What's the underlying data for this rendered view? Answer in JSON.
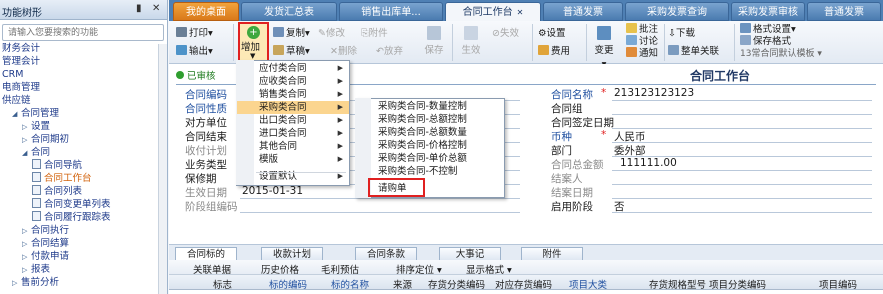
{
  "sidebar": {
    "title": "功能树形",
    "search_placeholder": "请输入您要搜索的功能",
    "items": [
      {
        "label": "财务会计",
        "level": 0,
        "type": "branch"
      },
      {
        "label": "管理会计",
        "level": 0,
        "type": "branch"
      },
      {
        "label": "CRM",
        "level": 0,
        "type": "branch"
      },
      {
        "label": "电商管理",
        "level": 0,
        "type": "branch"
      },
      {
        "label": "供应链",
        "level": 0,
        "type": "branch"
      },
      {
        "label": "合同管理",
        "level": 1,
        "type": "open"
      },
      {
        "label": "设置",
        "level": 2,
        "type": "closed"
      },
      {
        "label": "合同期初",
        "level": 2,
        "type": "closed"
      },
      {
        "label": "合同",
        "level": 2,
        "type": "open"
      },
      {
        "label": "合同导航",
        "level": 3,
        "type": "doc"
      },
      {
        "label": "合同工作台",
        "level": 3,
        "type": "doc",
        "selected": true
      },
      {
        "label": "合同列表",
        "level": 3,
        "type": "doc"
      },
      {
        "label": "合同变更单列表",
        "level": 3,
        "type": "doc"
      },
      {
        "label": "合同履行跟踪表",
        "level": 3,
        "type": "doc"
      },
      {
        "label": "合同执行",
        "level": 2,
        "type": "closed"
      },
      {
        "label": "合同结算",
        "level": 2,
        "type": "closed"
      },
      {
        "label": "付款申请",
        "level": 2,
        "type": "closed"
      },
      {
        "label": "报表",
        "level": 2,
        "type": "closed"
      },
      {
        "label": "售前分析",
        "level": 1,
        "type": "closed"
      }
    ]
  },
  "tabs": [
    {
      "label": "我的桌面"
    },
    {
      "label": "发货汇总表"
    },
    {
      "label": "销售出库单..."
    },
    {
      "label": "合同工作台"
    },
    {
      "label": "普通发票"
    },
    {
      "label": "采购发票查询"
    },
    {
      "label": "采购发票审核"
    },
    {
      "label": "普通发票"
    }
  ],
  "toolbar": {
    "print": "打印",
    "export": "输出",
    "add": "增加",
    "copy": "复制",
    "modify": "修改",
    "attachment": "附件",
    "draft": "草稿",
    "delete": "删除",
    "discard": "放弃",
    "save": "保存",
    "effective": "生效",
    "invalid": "失效",
    "settings": "设置",
    "expense": "费用",
    "change": "变更",
    "annotate": "批注",
    "discuss": "讨论",
    "notify": "通知",
    "download": "下载",
    "doc_link": "整单关联",
    "format_settings": "格式设置",
    "save_format": "保存格式",
    "template": "13常合同默认模板"
  },
  "form": {
    "status": "已审核",
    "title": "合同工作台",
    "left_labels": [
      {
        "text": "合同编码",
        "style": "blue"
      },
      {
        "text": "合同性质",
        "style": "blue"
      },
      {
        "text": "对方单位",
        "style": "normal"
      },
      {
        "text": "合同结束",
        "style": "normal"
      },
      {
        "text": "收付计划",
        "style": "gray"
      },
      {
        "text": "业务类型",
        "style": "normal"
      },
      {
        "text": "保修期",
        "style": "normal"
      },
      {
        "text": "生效日期",
        "style": "gray"
      },
      {
        "text": "阶段组编码",
        "style": "gray"
      }
    ],
    "effective_date": "2015-01-31",
    "right_fields": [
      {
        "label": "合同名称",
        "style": "blue",
        "required": true,
        "value": "213123123123"
      },
      {
        "label": "合同组",
        "style": "normal",
        "required": false,
        "value": ""
      },
      {
        "label": "合同签定日期",
        "style": "normal",
        "required": false,
        "value": ""
      },
      {
        "label": "币种",
        "style": "blue",
        "required": true,
        "value": "人民币"
      },
      {
        "label": "部门",
        "style": "normal",
        "required": false,
        "value": "委外部"
      },
      {
        "label": "合同总金额",
        "style": "gray",
        "required": false,
        "value": "111111.00"
      },
      {
        "label": "结案人",
        "style": "gray",
        "required": false,
        "value": ""
      },
      {
        "label": "结案日期",
        "style": "gray",
        "required": false,
        "value": ""
      },
      {
        "label": "启用阶段",
        "style": "normal",
        "required": false,
        "value": "否"
      }
    ]
  },
  "menu": {
    "items": [
      {
        "label": "应付类合同",
        "has_sub": true
      },
      {
        "label": "应收类合同",
        "has_sub": true
      },
      {
        "label": "销售类合同",
        "has_sub": true
      },
      {
        "label": "采购类合同",
        "has_sub": true,
        "highlighted": true
      },
      {
        "label": "出口类合同",
        "has_sub": true
      },
      {
        "label": "进口类合同",
        "has_sub": true
      },
      {
        "label": "其他合同",
        "has_sub": true
      },
      {
        "label": "模版",
        "has_sub": true
      },
      {
        "label": "设置默认",
        "has_sub": true
      }
    ],
    "submenu": [
      {
        "label": "采购类合同-数量控制"
      },
      {
        "label": "采购类合同-总额控制"
      },
      {
        "label": "采购类合同-总额数量"
      },
      {
        "label": "采购类合同-价格控制"
      },
      {
        "label": "采购类合同-单价总额"
      },
      {
        "label": "采购类合同-不控制"
      },
      {
        "label": "请购单",
        "highlighted": true
      }
    ]
  },
  "bottom": {
    "tabs": [
      "合同标的",
      "收款计划",
      "合同条款",
      "大事记",
      "附件"
    ],
    "tools": [
      "关联单据",
      "历史价格",
      "毛利预估",
      "排序定位",
      "显示格式"
    ],
    "columns": [
      {
        "label": "标志",
        "style": "gray"
      },
      {
        "label": "标的编码",
        "style": "blue"
      },
      {
        "label": "标的名称",
        "style": "blue"
      },
      {
        "label": "来源",
        "style": "normal"
      },
      {
        "label": "存货分类编码",
        "style": "normal"
      },
      {
        "label": "对应存货编码",
        "style": "normal"
      },
      {
        "label": "项目大类",
        "style": "blue"
      },
      {
        "label": "存货规格型号",
        "style": "normal"
      },
      {
        "label": "项目分类编码",
        "style": "normal"
      },
      {
        "label": "项目编码",
        "style": "normal"
      }
    ]
  },
  "colors": {
    "tab_bar": "#4f80b4",
    "home_tab": "#e8892a",
    "menu_highlight": "#fbd58f",
    "annotation_red": "#e02020",
    "required_star": "#e02020",
    "link_blue": "#2050a0"
  }
}
